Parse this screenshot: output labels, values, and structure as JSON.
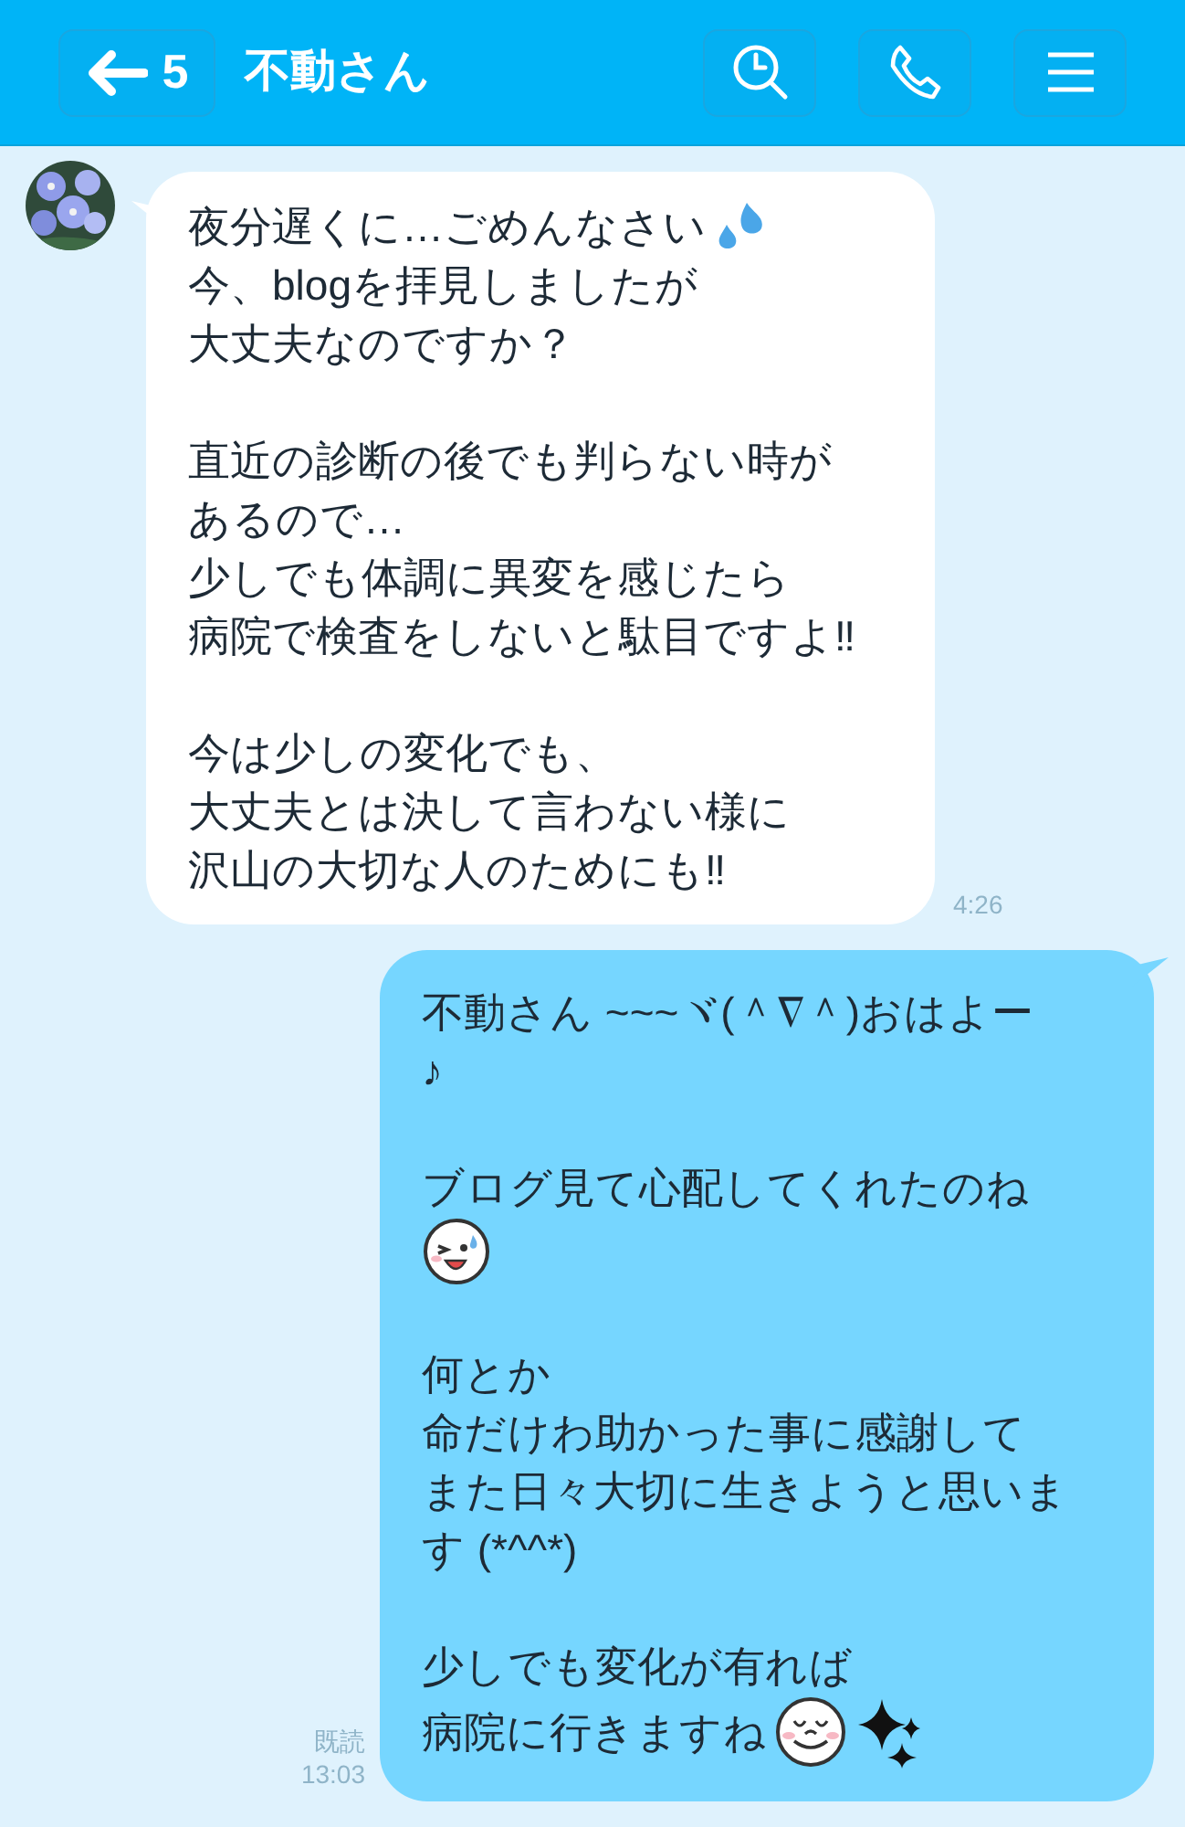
{
  "header": {
    "back_count": "5",
    "title": "不動さん"
  },
  "messages": [
    {
      "kind": "incoming",
      "time": "4:26",
      "paragraphs": [
        [
          [
            {
              "kind": "text",
              "text": "夜分遅くに…ごめんなさい"
            },
            {
              "kind": "sweat"
            }
          ],
          [
            {
              "kind": "text",
              "text": "今、blogを拝見しましたが"
            }
          ],
          [
            {
              "kind": "text",
              "text": "大丈夫なのですか？"
            }
          ]
        ],
        [
          [
            {
              "kind": "text",
              "text": "直近の診断の後でも判らない時が"
            }
          ],
          [
            {
              "kind": "text",
              "text": "あるので…"
            }
          ],
          [
            {
              "kind": "text",
              "text": "少しでも体調に異変を感じたら"
            }
          ],
          [
            {
              "kind": "text",
              "text": "病院で検査をしないと駄目ですよ‼"
            }
          ]
        ],
        [
          [
            {
              "kind": "text",
              "text": "今は少しの変化でも、"
            }
          ],
          [
            {
              "kind": "text",
              "text": "大丈夫とは決して言わない様に"
            }
          ],
          [
            {
              "kind": "text",
              "text": "沢山の大切な人のためにも‼"
            }
          ]
        ]
      ]
    },
    {
      "kind": "outgoing",
      "read": "既読",
      "time": "13:03",
      "paragraphs": [
        [
          [
            {
              "kind": "text",
              "text": "不動さん ~~~ヾ(＾∇＾)おはよー"
            }
          ],
          [
            {
              "kind": "text",
              "text": "♪"
            }
          ]
        ],
        [
          [
            {
              "kind": "text",
              "text": "ブログ見て心配してくれたのね"
            }
          ],
          [
            {
              "kind": "wink"
            }
          ]
        ],
        [
          [
            {
              "kind": "text",
              "text": "何とか"
            }
          ],
          [
            {
              "kind": "text",
              "text": "命だけわ助かった事に感謝して"
            }
          ],
          [
            {
              "kind": "text",
              "text": "また日々大切に生きようと思いま"
            }
          ],
          [
            {
              "kind": "text",
              "text": "す (*^^*)"
            }
          ]
        ],
        [
          [
            {
              "kind": "text",
              "text": "少しでも変化が有れば"
            }
          ],
          [
            {
              "kind": "text",
              "text": "病院に行きますね"
            },
            {
              "kind": "smile"
            },
            {
              "kind": "sparkles"
            }
          ]
        ]
      ]
    }
  ]
}
